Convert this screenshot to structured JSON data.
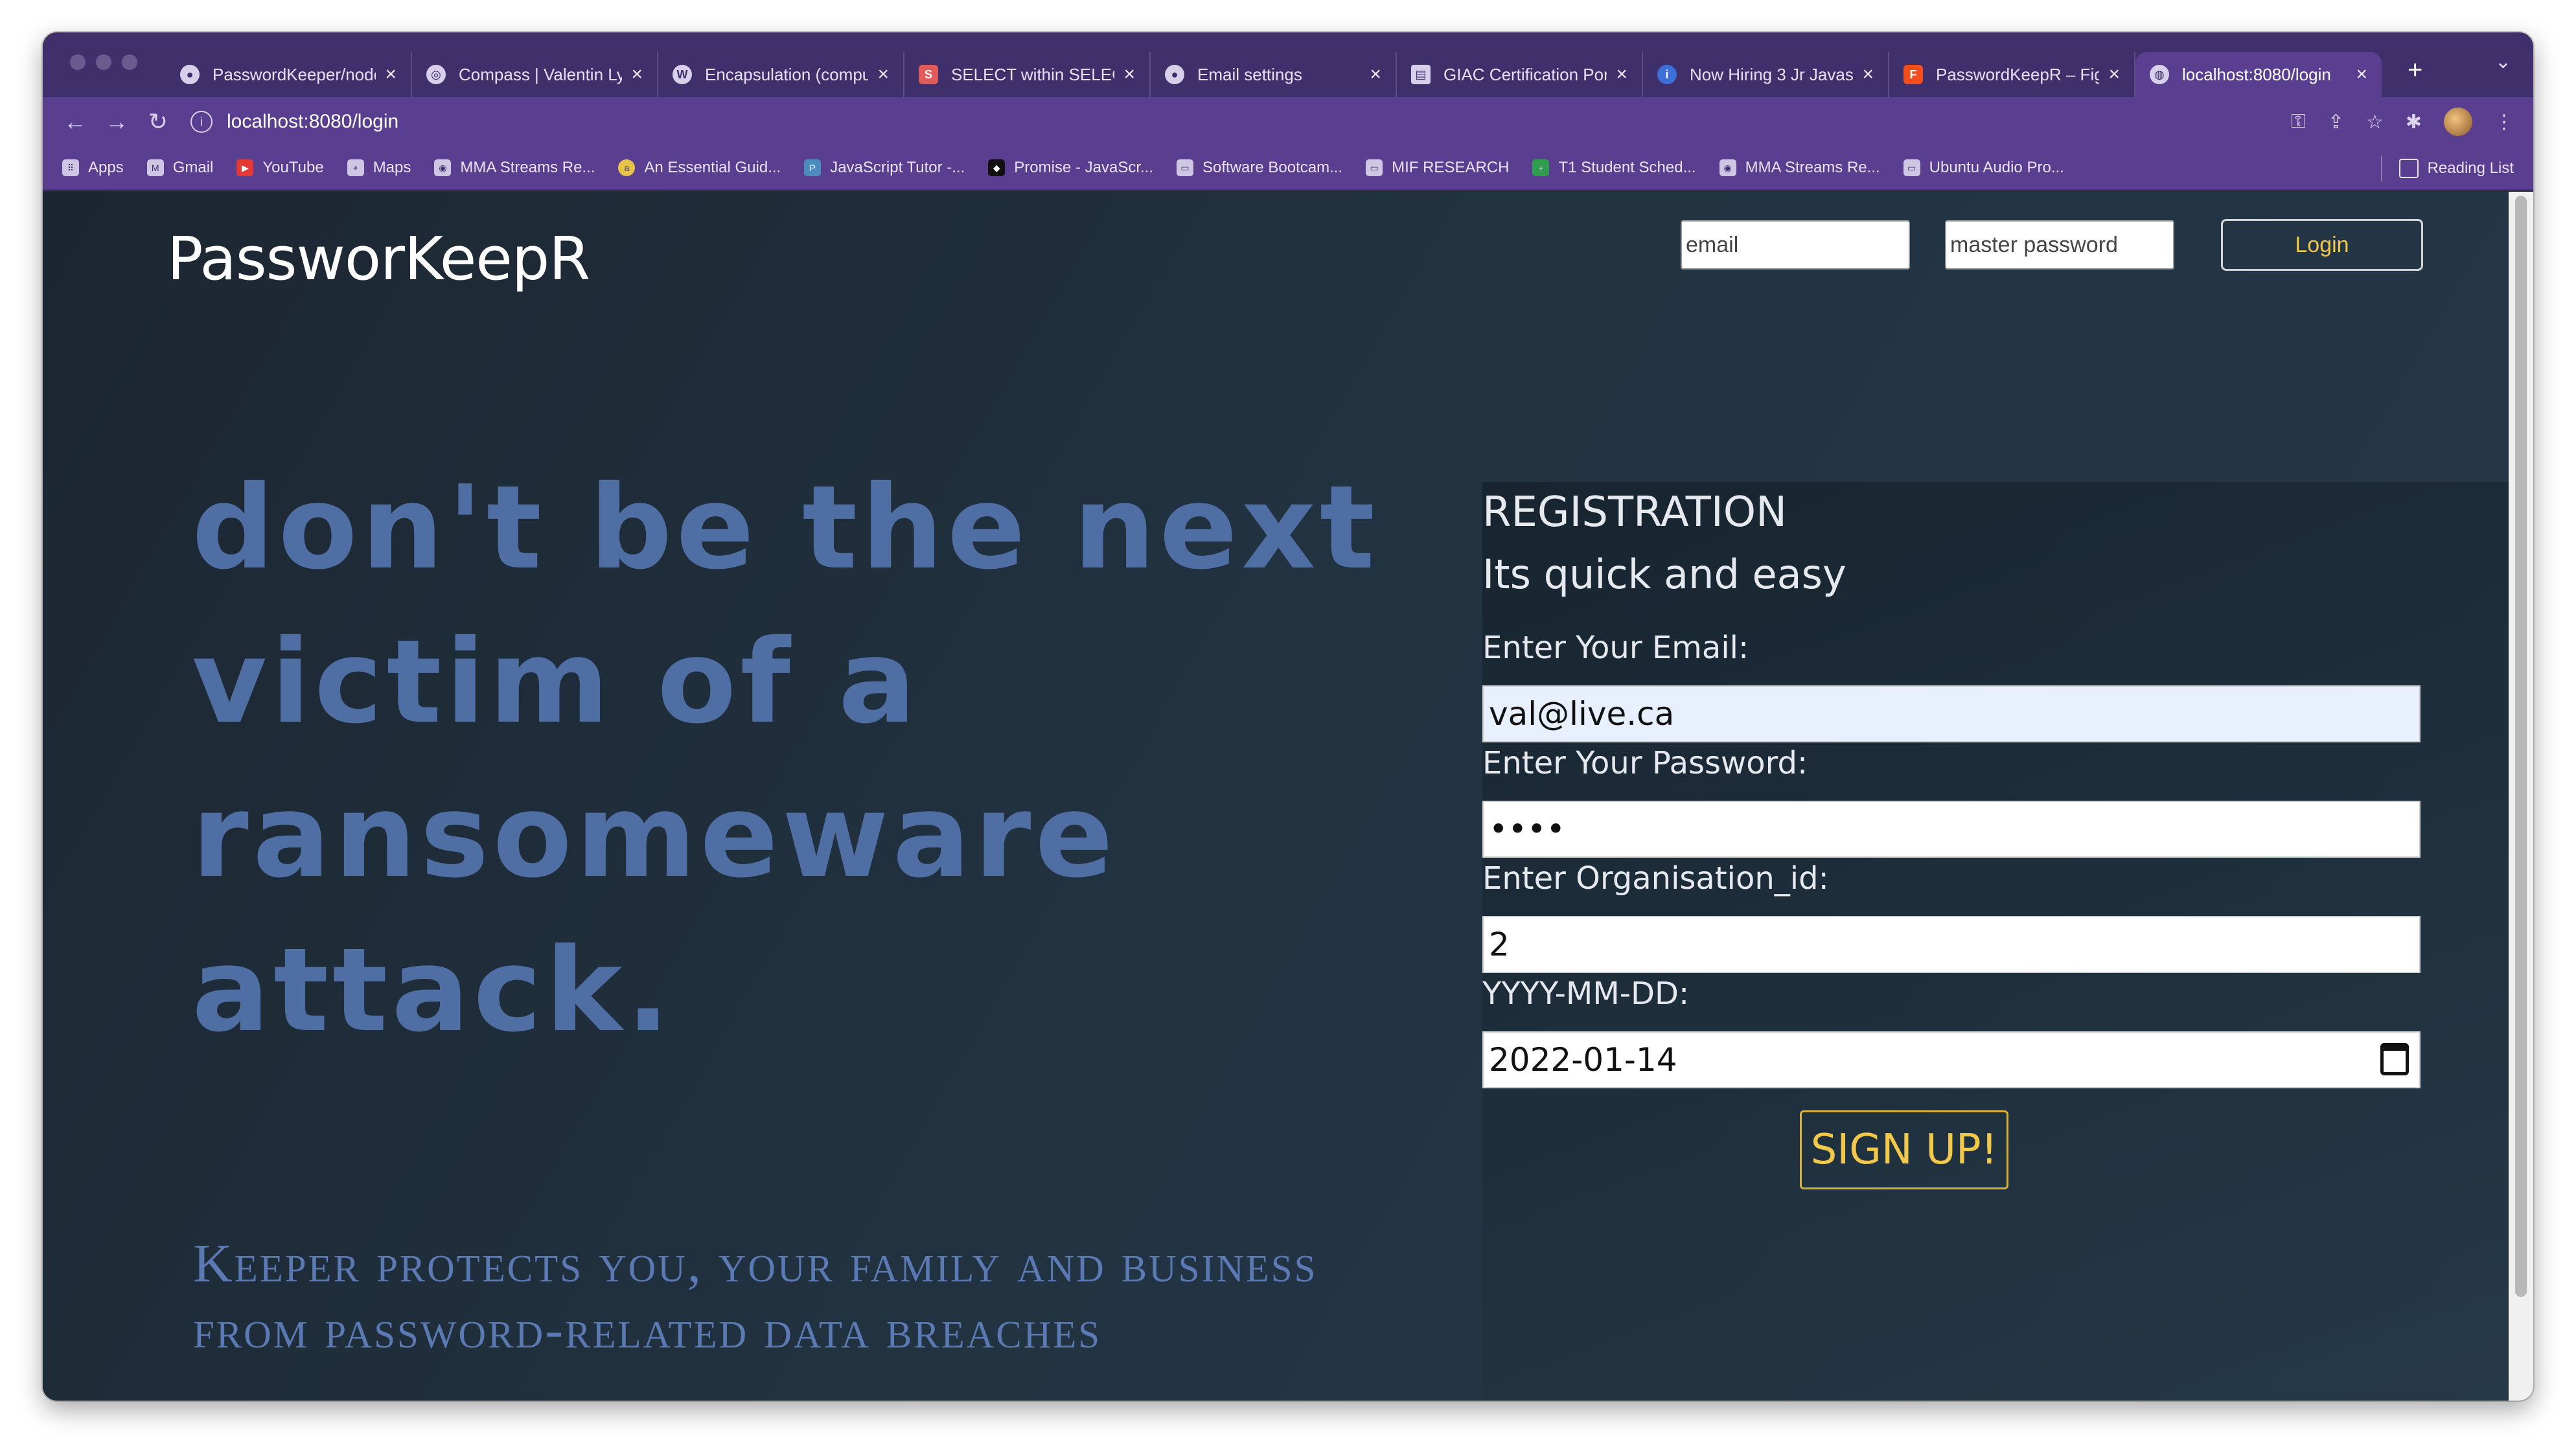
{
  "browser": {
    "tabs": [
      {
        "label": "PasswordKeeper/node",
        "icon": "github-icon"
      },
      {
        "label": "Compass | Valentin Ly",
        "icon": "compass-icon"
      },
      {
        "label": "Encapsulation (compu",
        "icon": "wikipedia-icon"
      },
      {
        "label": "SELECT within SELEC",
        "icon": "database-icon"
      },
      {
        "label": "Email settings",
        "icon": "github-icon"
      },
      {
        "label": "GIAC Certification Por",
        "icon": "page-icon"
      },
      {
        "label": "Now Hiring 3 Jr Javas",
        "icon": "info-icon"
      },
      {
        "label": "PasswordKeepR – Fig",
        "icon": "figma-icon"
      },
      {
        "label": "localhost:8080/login",
        "icon": "globe-icon",
        "active": true
      }
    ],
    "url": "localhost:8080/login",
    "bookmarks": [
      {
        "label": "Apps",
        "icon": "apps-icon"
      },
      {
        "label": "Gmail",
        "icon": "gmail-icon"
      },
      {
        "label": "YouTube",
        "icon": "youtube-icon"
      },
      {
        "label": "Maps",
        "icon": "maps-icon"
      },
      {
        "label": "MMA Streams Re...",
        "icon": "mma-icon"
      },
      {
        "label": "An Essential Guid...",
        "icon": "guide-icon"
      },
      {
        "label": "JavaScript Tutor -...",
        "icon": "python-icon"
      },
      {
        "label": "Promise - JavaScr...",
        "icon": "promise-icon"
      },
      {
        "label": "Software Bootcam...",
        "icon": "folder-icon"
      },
      {
        "label": "MIF RESEARCH",
        "icon": "folder-icon"
      },
      {
        "label": "T1 Student Sched...",
        "icon": "sheet-icon"
      },
      {
        "label": "MMA Streams Re...",
        "icon": "mma-icon"
      },
      {
        "label": "Ubuntu Audio Pro...",
        "icon": "folder-icon"
      }
    ],
    "reading_list": "Reading List"
  },
  "header": {
    "brand": "PassworKeepR",
    "email_placeholder": "email",
    "password_placeholder": "master password",
    "login_label": "Login"
  },
  "hero": {
    "headline": "Don't be the next victim of a ransomeware attack.",
    "subtext": "Keeper protects you, your family and business from password-related data breaches"
  },
  "registration": {
    "title": "REGISTRATION",
    "subtitle": "Its quick and easy",
    "email_label": "Enter Your Email:",
    "email_value": "val@live.ca",
    "password_label": "Enter Your Password:",
    "password_value": "••••",
    "org_label": "Enter Organisation_id:",
    "org_value": "2",
    "date_label": "YYYY-MM-DD:",
    "date_value": "2022-01-14",
    "signup_label": "SIGN UP!"
  },
  "colors": {
    "accent": "#f2c84b",
    "hero_text": "#4f6ea4",
    "browser_chrome": "#5a3f91"
  }
}
